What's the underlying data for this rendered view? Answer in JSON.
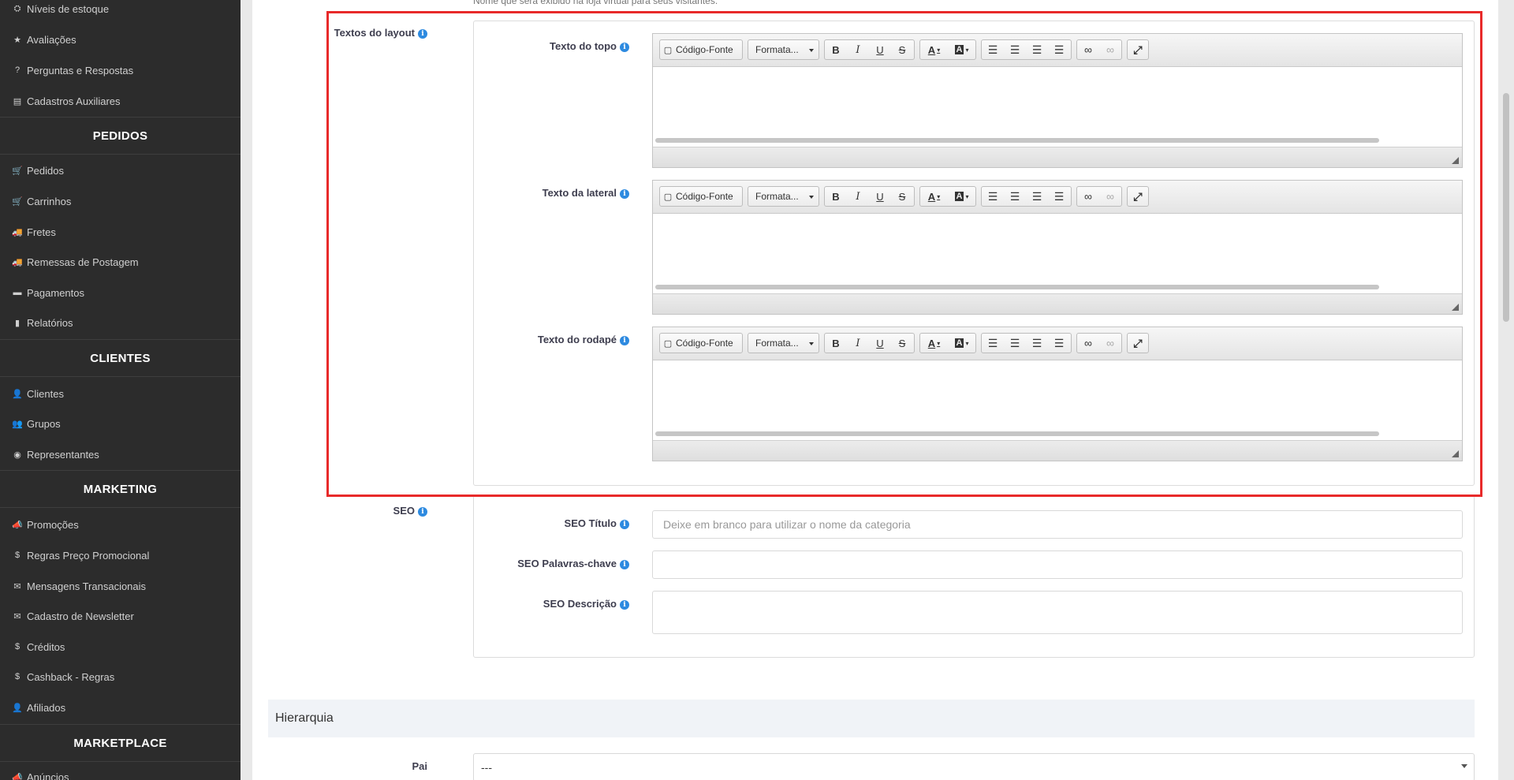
{
  "sidebar": {
    "items_top": [
      {
        "icon": "⛭",
        "label": "Níveis de estoque"
      },
      {
        "icon": "★",
        "label": "Avaliações"
      },
      {
        "icon": "?",
        "label": "Perguntas e Respostas"
      },
      {
        "icon": "▤",
        "label": "Cadastros Auxiliares"
      }
    ],
    "pedidos_title": "PEDIDOS",
    "pedidos": [
      {
        "icon": "🛒",
        "label": "Pedidos"
      },
      {
        "icon": "🛒",
        "label": "Carrinhos"
      },
      {
        "icon": "🚚",
        "label": "Fretes"
      },
      {
        "icon": "🚚",
        "label": "Remessas de Postagem"
      },
      {
        "icon": "▬",
        "label": "Pagamentos"
      },
      {
        "icon": "▮",
        "label": "Relatórios"
      }
    ],
    "clientes_title": "CLIENTES",
    "clientes": [
      {
        "icon": "👤",
        "label": "Clientes"
      },
      {
        "icon": "👥",
        "label": "Grupos"
      },
      {
        "icon": "◉",
        "label": "Representantes"
      }
    ],
    "marketing_title": "MARKETING",
    "marketing": [
      {
        "icon": "📣",
        "label": "Promoções"
      },
      {
        "icon": "$",
        "label": "Regras Preço Promocional"
      },
      {
        "icon": "✉",
        "label": "Mensagens Transacionais"
      },
      {
        "icon": "✉",
        "label": "Cadastro de Newsletter"
      },
      {
        "icon": "$",
        "label": "Créditos"
      },
      {
        "icon": "$",
        "label": "Cashback - Regras"
      },
      {
        "icon": "👤",
        "label": "Afiliados"
      }
    ],
    "marketplace_title": "MARKETPLACE",
    "marketplace": [
      {
        "icon": "📣",
        "label": "Anúncios"
      }
    ]
  },
  "main": {
    "name_hint": "Nome que será exibido na loja virtual para seus visitantes.",
    "layout_section": {
      "label": "Textos do layout",
      "editors": [
        {
          "label": "Texto do topo"
        },
        {
          "label": "Texto da lateral"
        },
        {
          "label": "Texto do rodapé"
        }
      ]
    },
    "toolbar": {
      "source": "Código-Fonte",
      "format": "Formata...",
      "bold": "B",
      "italic": "I",
      "underline": "U",
      "strike": "S",
      "text_color": "A",
      "bg_color": "A"
    },
    "seo": {
      "label": "SEO",
      "title_label": "SEO Título",
      "title_placeholder": "Deixe em branco para utilizar o nome da categoria",
      "keywords_label": "SEO Palavras-chave",
      "description_label": "SEO Descrição"
    },
    "hierarchy": {
      "title": "Hierarquia",
      "parent_label": "Pai",
      "parent_value": "---"
    }
  },
  "colors": {
    "sidebar_bg": "#2c2c2c",
    "highlight": "#e82a2a",
    "info_icon": "#2d8ae0"
  }
}
